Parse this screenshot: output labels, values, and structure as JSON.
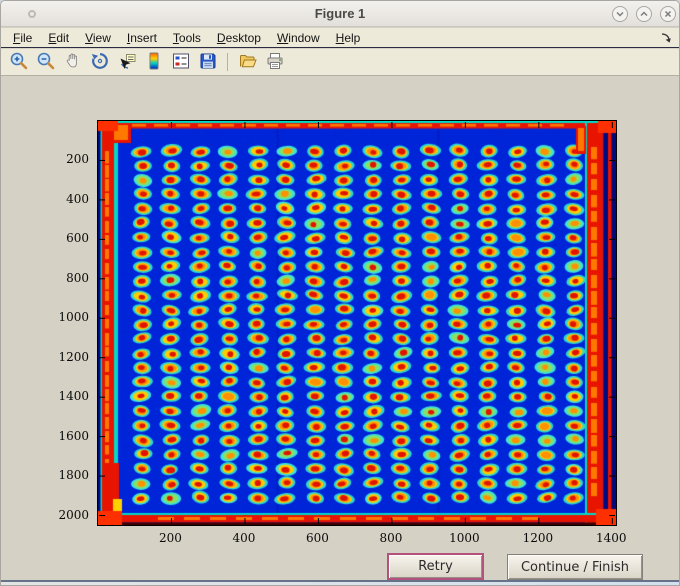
{
  "window": {
    "title": "Figure 1",
    "controls": [
      {
        "name": "shade-window-button",
        "icon": "chevron-down-icon"
      },
      {
        "name": "maximize-window-button",
        "icon": "chevron-up-icon"
      },
      {
        "name": "close-window-button",
        "icon": "close-icon"
      }
    ]
  },
  "menu_bar": {
    "items": [
      {
        "label": "File"
      },
      {
        "label": "Edit"
      },
      {
        "label": "View"
      },
      {
        "label": "Insert"
      },
      {
        "label": "Tools"
      },
      {
        "label": "Desktop"
      },
      {
        "label": "Window"
      },
      {
        "label": "Help"
      }
    ],
    "dock_icon": "dock-figure-icon"
  },
  "toolbar": {
    "buttons": [
      {
        "name": "zoom-in-button",
        "icon": "zoom-in-icon"
      },
      {
        "name": "zoom-out-button",
        "icon": "zoom-out-icon"
      },
      {
        "name": "pan-button",
        "icon": "hand-icon"
      },
      {
        "name": "rotate-3d-button",
        "icon": "rotate-icon"
      },
      {
        "name": "data-cursor-button",
        "icon": "data-cursor-icon"
      },
      {
        "name": "colorbar-button",
        "icon": "colorbar-icon"
      },
      {
        "name": "insert-legend-button",
        "icon": "legend-icon"
      },
      {
        "name": "save-button",
        "icon": "floppy-icon"
      },
      {
        "separator": true
      },
      {
        "name": "open-button",
        "icon": "folder-icon"
      },
      {
        "name": "print-button",
        "icon": "printer-icon"
      }
    ]
  },
  "figure": {
    "axes": {
      "x_ticks": [
        200,
        400,
        600,
        800,
        1000,
        1200,
        1400
      ],
      "y_ticks": [
        200,
        400,
        600,
        800,
        1000,
        1200,
        1400,
        1600,
        1800,
        2000
      ],
      "x_range": [
        0,
        1410
      ],
      "y_range": [
        0,
        2048
      ],
      "tick_direction": "in",
      "box": true
    },
    "image": {
      "type": "heatmap",
      "colormap": "jet",
      "description": "Microplate scan: 16 x 25 grid of spots (red cores, yellow rings, cyan halos) on blue background with hot red edge artifacts on all four borders",
      "grid_cols": 16,
      "grid_rows": 25,
      "seed": 7,
      "colors": {
        "background": "#0024d8",
        "halo": "#2ed8d0",
        "ring": "#ffcc00",
        "ring_hot": "#ff9000",
        "core": "#e01400",
        "weak": "#8ce060",
        "edge_red": "#e81400",
        "edge_orange": "#ff7800",
        "edge_yellow": "#ffd000",
        "edge_cyan": "#00d8c8",
        "edge_dark": "#000a78"
      }
    }
  },
  "action_buttons": {
    "retry": "Retry",
    "continue_finish": "Continue / Finish"
  }
}
